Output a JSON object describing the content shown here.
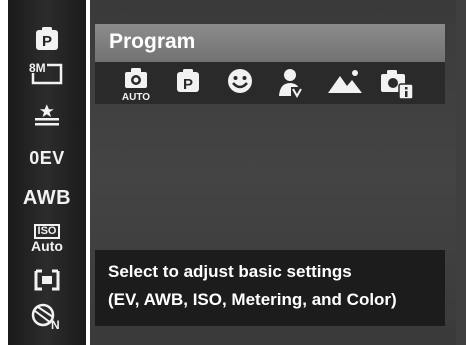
{
  "sidebar": {
    "items": [
      {
        "name": "program-mode-icon",
        "label": ""
      },
      {
        "name": "image-size-8m-icon",
        "label": ""
      },
      {
        "name": "quality-icon",
        "label": ""
      },
      {
        "name": "exposure-value-item",
        "label": "0EV"
      },
      {
        "name": "white-balance-item",
        "label": "AWB"
      },
      {
        "name": "iso-item",
        "label_top": "ISO",
        "label_bottom": "Auto"
      },
      {
        "name": "metering-icon",
        "label": ""
      },
      {
        "name": "color-mode-icon",
        "label": ""
      }
    ],
    "image_size_label": "8M"
  },
  "panel": {
    "title": "Program",
    "modes": [
      {
        "icon": "auto-camera-icon",
        "sublabel": "AUTO"
      },
      {
        "icon": "program-mode-icon"
      },
      {
        "icon": "smile-detection-icon"
      },
      {
        "icon": "portrait-mode-icon"
      },
      {
        "icon": "landscape-mode-icon"
      },
      {
        "icon": "camera-info-icon"
      }
    ],
    "hint": {
      "line1": "Select to adjust basic settings",
      "line2": "(EV, AWB, ISO, Metering, and Color)"
    }
  }
}
